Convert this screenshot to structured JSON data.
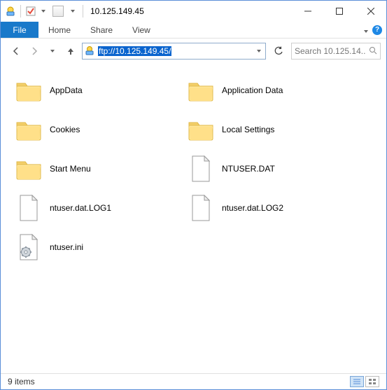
{
  "window": {
    "title": "10.125.149.45"
  },
  "ribbon": {
    "file": "File",
    "tabs": [
      "Home",
      "Share",
      "View"
    ]
  },
  "nav": {
    "address": "ftp://10.125.149.45/",
    "search_placeholder": "Search 10.125.14..."
  },
  "items": [
    {
      "type": "folder",
      "label": "AppData"
    },
    {
      "type": "folder",
      "label": "Application Data"
    },
    {
      "type": "folder",
      "label": "Cookies"
    },
    {
      "type": "folder",
      "label": "Local Settings"
    },
    {
      "type": "folder",
      "label": "Start Menu"
    },
    {
      "type": "file",
      "label": "NTUSER.DAT"
    },
    {
      "type": "file",
      "label": "ntuser.dat.LOG1"
    },
    {
      "type": "file",
      "label": "ntuser.dat.LOG2"
    },
    {
      "type": "ini",
      "label": "ntuser.ini"
    }
  ],
  "status": {
    "text": "9 items"
  }
}
